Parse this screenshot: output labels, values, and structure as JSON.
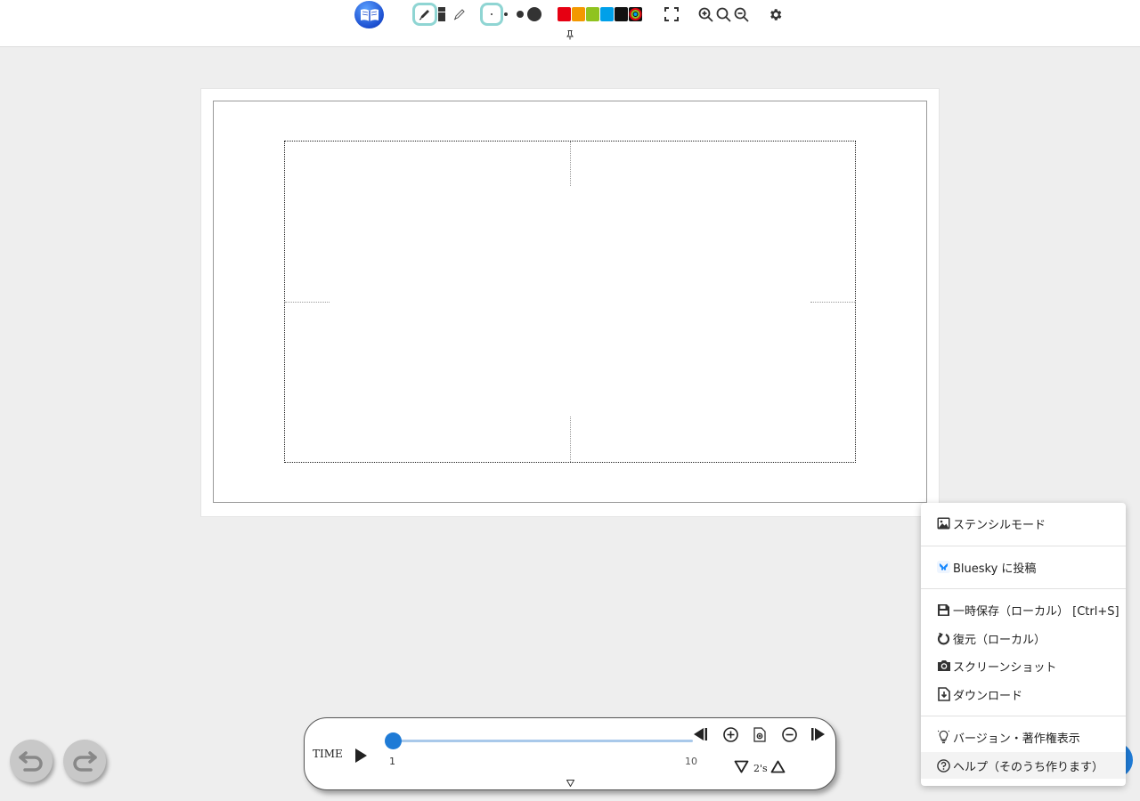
{
  "toolbar": {
    "icons": {
      "logo": "book-logo-icon",
      "pen": "pen-icon",
      "eraser": "eraser-icon",
      "pencil": "pencil-icon",
      "fullscreen": "fullscreen-icon",
      "zoom_in": "zoom-in-icon",
      "zoom_reset": "zoom-reset-icon",
      "zoom_out": "zoom-out-icon",
      "settings": "gear-icon",
      "pin": "pin-icon"
    },
    "brush_sizes": [
      "tiny",
      "small",
      "medium",
      "large"
    ],
    "colors": [
      "#e60012",
      "#f39800",
      "#8fc31f",
      "#00a0e9",
      "#111111",
      "custom"
    ]
  },
  "timeline": {
    "label": "TIME",
    "frame_start": "1",
    "frame_end": "10",
    "current_frame": 1,
    "speed": "2's",
    "icons": {
      "play": "play-icon",
      "prev": "step-back-icon",
      "add": "add-frame-icon",
      "copy": "copy-frame-icon",
      "remove": "remove-frame-icon",
      "next": "step-forward-icon",
      "speed_down": "speed-down-icon",
      "speed_up": "speed-up-icon",
      "collapse": "collapse-icon"
    }
  },
  "history": {
    "undo_icon": "undo-icon",
    "redo_icon": "redo-icon"
  },
  "menu": {
    "items": [
      {
        "label": "ステンシルモード",
        "icon": "image-icon"
      },
      {
        "label": "Bluesky に投稿",
        "icon": "bluesky-icon"
      },
      {
        "label": "一時保存（ローカル） [Ctrl+S]",
        "icon": "save-icon"
      },
      {
        "label": "復元（ローカル）",
        "icon": "restore-icon"
      },
      {
        "label": "スクリーンショット",
        "icon": "camera-icon"
      },
      {
        "label": "ダウンロード",
        "icon": "download-icon"
      },
      {
        "label": "バージョン・著作権表示",
        "icon": "lightbulb-icon"
      },
      {
        "label": "ヘルプ（そのうち作ります）",
        "icon": "help-icon"
      }
    ]
  }
}
